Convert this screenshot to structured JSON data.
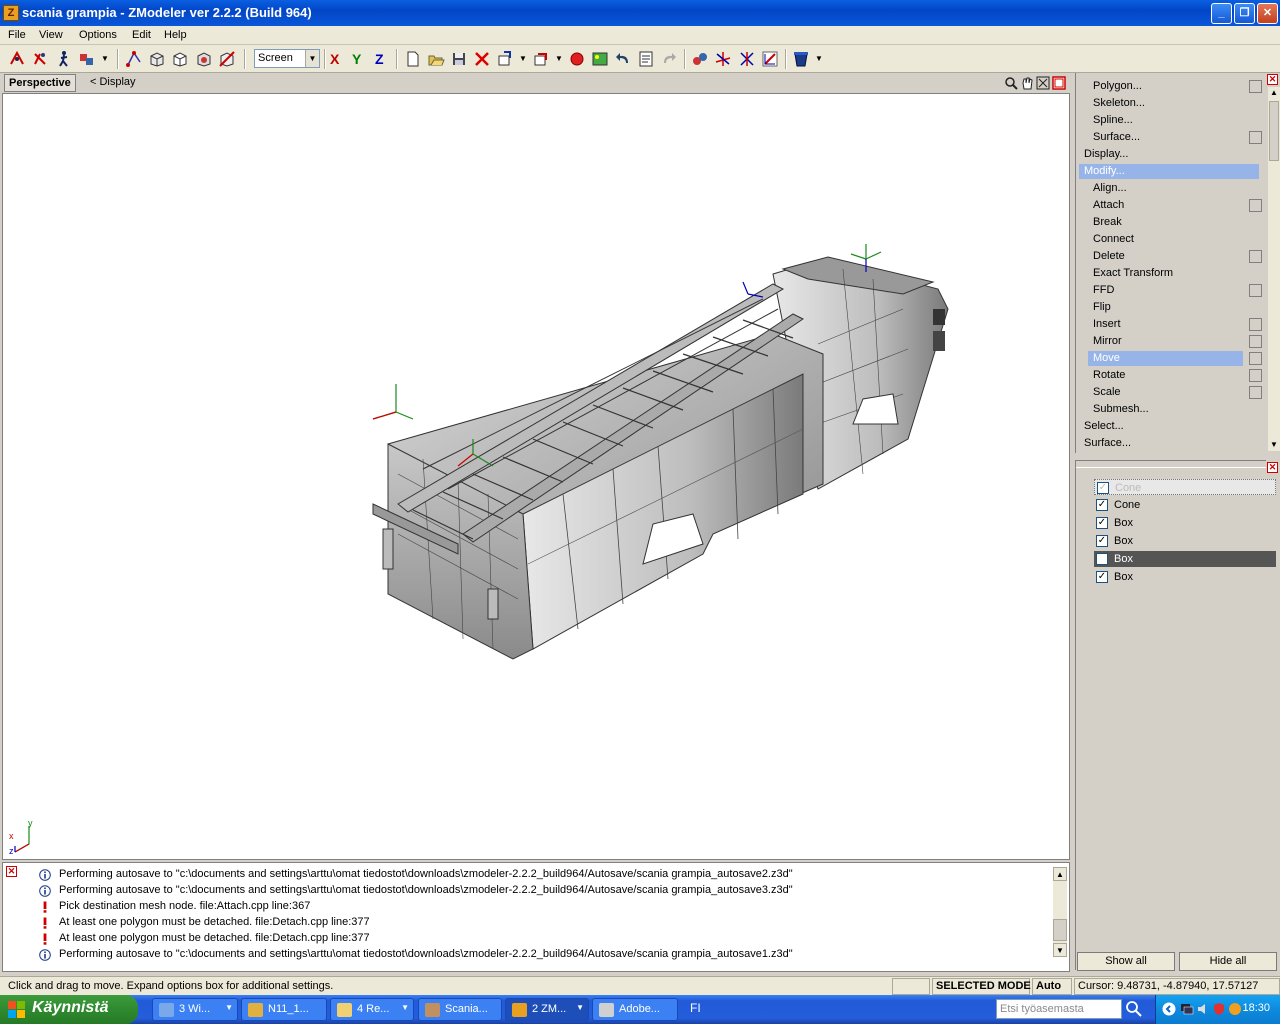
{
  "window": {
    "title": "scania grampia - ZModeler ver 2.2.2 (Build 964)",
    "app_icon_letter": "Z"
  },
  "menu": [
    "File",
    "View",
    "Options",
    "Edit",
    "Help"
  ],
  "toolbar": {
    "space_select": "Screen",
    "axes": [
      "X",
      "Y",
      "Z"
    ],
    "axis_colors": [
      "#c00000",
      "#008000",
      "#0000c0"
    ]
  },
  "viewport": {
    "name": "Perspective",
    "display_link": "< Display",
    "axis_labels": [
      "y",
      "x",
      "z"
    ]
  },
  "command_panel": {
    "items": [
      {
        "label": "Polygon...",
        "indent": true,
        "box": true
      },
      {
        "label": "Skeleton...",
        "indent": true,
        "box": false
      },
      {
        "label": "Spline...",
        "indent": true,
        "box": false
      },
      {
        "label": "Surface...",
        "indent": true,
        "box": true
      },
      {
        "label": "Display...",
        "indent": false,
        "box": false
      },
      {
        "label": "Modify...",
        "indent": false,
        "box": false,
        "selected": true
      },
      {
        "label": "Align...",
        "indent": true,
        "box": false
      },
      {
        "label": "Attach",
        "indent": true,
        "box": true
      },
      {
        "label": "Break",
        "indent": true,
        "box": false
      },
      {
        "label": "Connect",
        "indent": true,
        "box": false
      },
      {
        "label": "Delete",
        "indent": true,
        "box": true
      },
      {
        "label": "Exact Transform",
        "indent": true,
        "box": false
      },
      {
        "label": "FFD",
        "indent": true,
        "box": true
      },
      {
        "label": "Flip",
        "indent": true,
        "box": false
      },
      {
        "label": "Insert",
        "indent": true,
        "box": true
      },
      {
        "label": "Mirror",
        "indent": true,
        "box": true
      },
      {
        "label": "Move",
        "indent": true,
        "box": true,
        "selected": true
      },
      {
        "label": "Rotate",
        "indent": true,
        "box": true
      },
      {
        "label": "Scale",
        "indent": true,
        "box": true
      },
      {
        "label": "Submesh...",
        "indent": true,
        "box": false
      },
      {
        "label": "Select...",
        "indent": false,
        "box": false
      },
      {
        "label": "Surface...",
        "indent": false,
        "box": false
      }
    ]
  },
  "objects": {
    "items": [
      {
        "label": "Cone",
        "checked": true,
        "style": "ghost"
      },
      {
        "label": "Cone",
        "checked": true,
        "style": "normal"
      },
      {
        "label": "Box",
        "checked": true,
        "style": "normal"
      },
      {
        "label": "Box",
        "checked": true,
        "style": "normal"
      },
      {
        "label": "Box",
        "checked": true,
        "style": "dark"
      },
      {
        "label": "Box",
        "checked": true,
        "style": "normal"
      }
    ],
    "show_all": "Show all",
    "hide_all": "Hide all"
  },
  "log": [
    {
      "type": "info",
      "text": "Performing autosave to \"c:\\documents and settings\\arttu\\omat tiedostot\\downloads\\zmodeler-2.2.2_build964/Autosave/scania grampia_autosave2.z3d\""
    },
    {
      "type": "info",
      "text": "Performing autosave to \"c:\\documents and settings\\arttu\\omat tiedostot\\downloads\\zmodeler-2.2.2_build964/Autosave/scania grampia_autosave3.z3d\""
    },
    {
      "type": "warn",
      "text": "Pick destination mesh node. file:Attach.cpp line:367"
    },
    {
      "type": "warn",
      "text": "At least one polygon must be detached. file:Detach.cpp line:377"
    },
    {
      "type": "warn",
      "text": "At least one polygon must be detached. file:Detach.cpp line:377"
    },
    {
      "type": "info",
      "text": "Performing autosave to \"c:\\documents and settings\\arttu\\omat tiedostot\\downloads\\zmodeler-2.2.2_build964/Autosave/scania grampia_autosave1.z3d\""
    }
  ],
  "status": {
    "message": "Click and drag to move. Expand options box for additional settings.",
    "mode": "SELECTED MODE",
    "auto": "Auto",
    "cursor": "Cursor: 9.48731, -4.87940, 17.57127"
  },
  "taskbar": {
    "start": "Käynnistä",
    "tasks": [
      {
        "label": "3 Wi...",
        "color": "#7aa8e8",
        "arrow": true
      },
      {
        "label": "N11_1...",
        "color": "#e0b040",
        "arrow": false
      },
      {
        "label": "4 Re...",
        "color": "#f0d070",
        "arrow": true
      },
      {
        "label": "Scania...",
        "color": "#c09060",
        "arrow": false
      },
      {
        "label": "2 ZM...",
        "color": "#e8a020",
        "arrow": true,
        "active": true
      },
      {
        "label": "Adobe...",
        "color": "#d0d0d0",
        "arrow": false
      }
    ],
    "lang": "FI",
    "search_placeholder": "Etsi työasemasta",
    "clock": "18:30"
  }
}
